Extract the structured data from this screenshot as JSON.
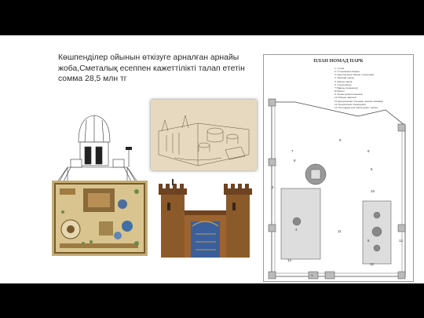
{
  "slide": {
    "title": "Көшпенділер ойынын өткізуге арналған арнайы жоба,Сметалық есеппен кажеттілікті талап ететін сомма 28,5 млн тг"
  },
  "plan": {
    "heading": "ПЛАН НОМАД ПАРК",
    "legend": [
      "1. Стена",
      "2. Сторожевые башни",
      "3. Центральные башни с воротами",
      "4. Ханский шатер",
      "5. Шатры ханов",
      "6. Стрельбище",
      "7.Навесы (конюшни)",
      "8.Помост",
      "9. Рынок ремесленников",
      "10. Монеж лавочей",
      "11.Центральная площадь, вышка семафор",
      "12.Технические помещения",
      "13. Площадка для зрительских трибун"
    ],
    "markers": [
      "1",
      "2",
      "2",
      "2",
      "2",
      "3",
      "3",
      "3",
      "4",
      "5",
      "5",
      "6",
      "7",
      "7",
      "8",
      "9",
      "9",
      "10",
      "11",
      "12",
      "13"
    ]
  },
  "images": {
    "tower_sketch": "tower-sketch",
    "perspective": "perspective-drawing",
    "colored_plan": "colored-plan",
    "towers_render": "towers-render"
  }
}
